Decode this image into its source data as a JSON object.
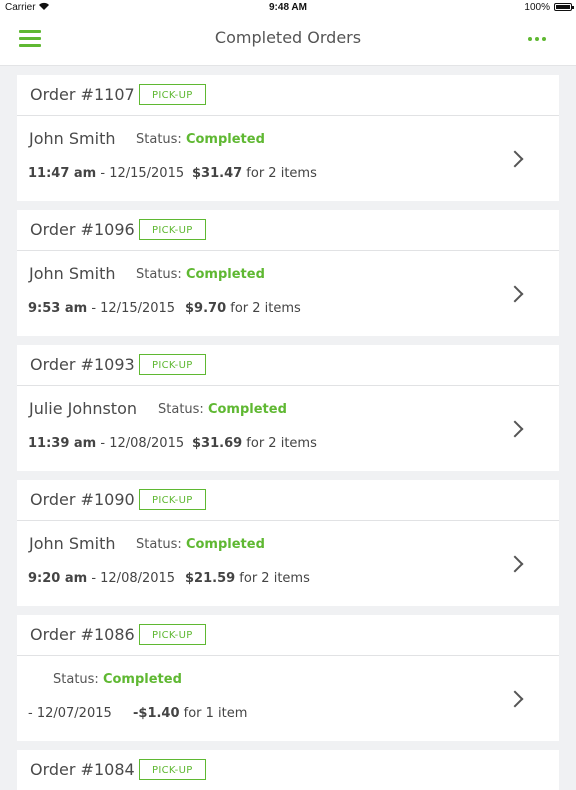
{
  "status_bar": {
    "carrier": "Carrier",
    "time": "9:48 AM",
    "battery": "100%"
  },
  "nav": {
    "title": "Completed Orders"
  },
  "orders": [
    {
      "number": "Order #1107",
      "badge": "PICK-UP",
      "customer": "John Smith",
      "status_label": "Status:",
      "status": "Completed",
      "time": "11:47 am",
      "date": " - 12/15/2015",
      "amount": "$31.47",
      "items": " for 2 items"
    },
    {
      "number": "Order #1096",
      "badge": "PICK-UP",
      "customer": "John Smith",
      "status_label": "Status:",
      "status": "Completed",
      "time": "9:53 am",
      "date": " - 12/15/2015",
      "amount": "$9.70",
      "items": " for 2 items"
    },
    {
      "number": "Order #1093",
      "badge": "PICK-UP",
      "customer": "Julie Johnston",
      "status_label": "Status:",
      "status": "Completed",
      "time": "11:39 am",
      "date": " - 12/08/2015",
      "amount": "$31.69",
      "items": " for 2 items"
    },
    {
      "number": "Order #1090",
      "badge": "PICK-UP",
      "customer": "John Smith",
      "status_label": "Status:",
      "status": "Completed",
      "time": "9:20 am",
      "date": " - 12/08/2015",
      "amount": "$21.59",
      "items": " for 2 items"
    },
    {
      "number": "Order #1086",
      "badge": "PICK-UP",
      "customer": "",
      "status_label": "Status:",
      "status": "Completed",
      "time": "",
      "date": "- 12/07/2015",
      "amount": "-$1.40",
      "items": " for 1 item"
    },
    {
      "number": "Order #1084",
      "badge": "PICK-UP"
    }
  ],
  "colors": {
    "accent": "#5fb832",
    "background": "#f0f1f3"
  }
}
